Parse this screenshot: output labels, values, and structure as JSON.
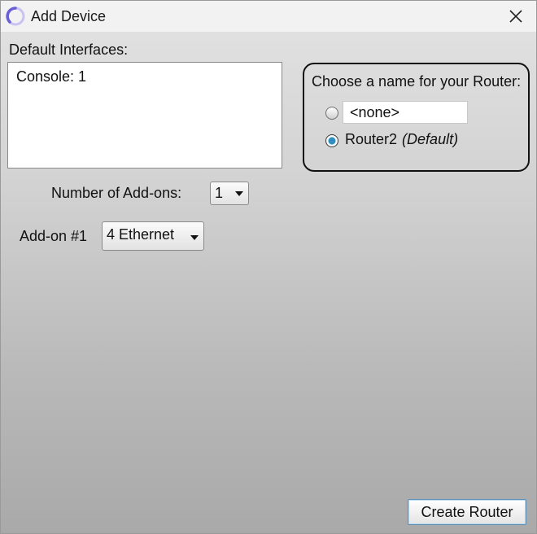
{
  "window": {
    "title": "Add Device",
    "app_icon": "device-app-icon",
    "close_icon": "close-icon"
  },
  "interfaces": {
    "label": "Default Interfaces:",
    "items": [
      "Console: 1"
    ]
  },
  "name_group": {
    "title": "Choose a name for your Router:",
    "custom_value": "<none>",
    "default_name": "Router2",
    "default_hint": "(Default)",
    "selected": "default"
  },
  "addons": {
    "count_label": "Number of Add-ons:",
    "count_value": "1",
    "addon1_label": "Add-on #1",
    "addon1_value": "4 Ethernet"
  },
  "footer": {
    "create_label": "Create Router"
  },
  "colors": {
    "radio_selected": "#2f8fc0",
    "button_border": "#5c8fb5"
  }
}
